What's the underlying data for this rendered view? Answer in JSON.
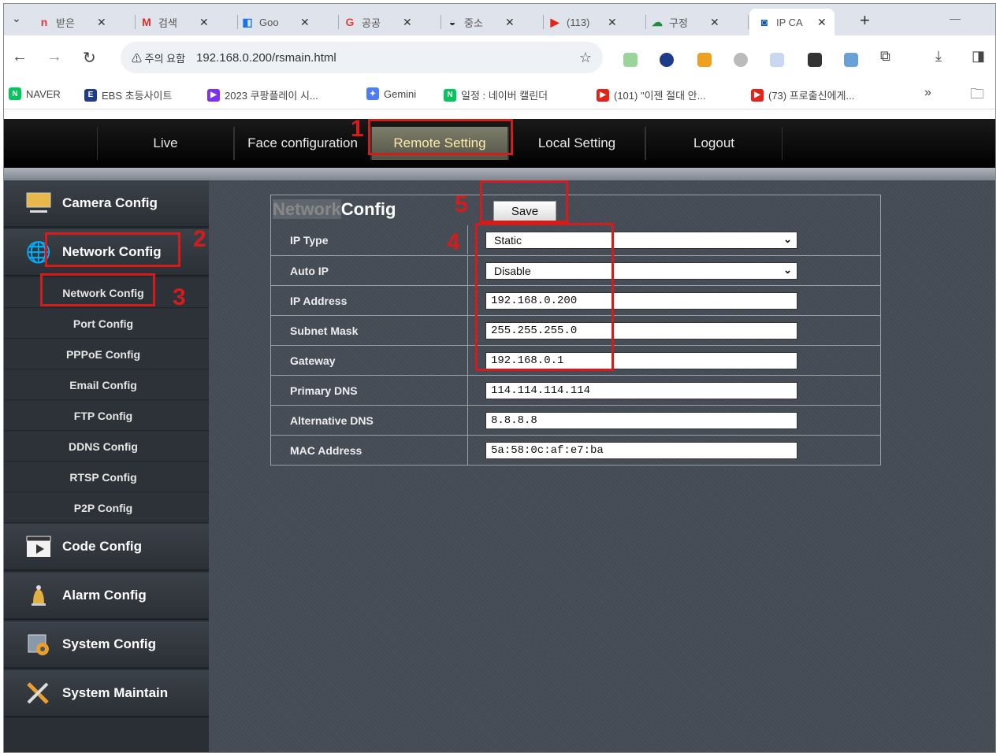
{
  "browser": {
    "tabs": [
      {
        "icon": "n",
        "label": "받은",
        "color": "#e8363c"
      },
      {
        "icon": "M",
        "label": "검색",
        "color": "#d93025"
      },
      {
        "icon": "◧",
        "label": "Goo",
        "color": "#1a73e8"
      },
      {
        "icon": "G",
        "label": "공공",
        "color": "#ea4335"
      },
      {
        "icon": "◒",
        "label": "중소",
        "color": "#333333"
      },
      {
        "icon": "▶",
        "label": "(113)",
        "color": "#e62117"
      },
      {
        "icon": "☁",
        "label": "구정",
        "color": "#1e8e3e"
      },
      {
        "icon": "◙",
        "label": "IP CA",
        "color": "#0b57a6"
      }
    ],
    "new_tab": "+",
    "minimize": "—",
    "tab_close": "✕",
    "url": "192.168.0.200/rsmain.html",
    "security_label": "⚠ 주의 요함",
    "bookmarks": [
      {
        "label": "NAVER",
        "icon": "N",
        "color": "#03c75a"
      },
      {
        "label": "EBS 초등사이트",
        "icon": "E",
        "color": "#1f3c88"
      },
      {
        "label": "2023 쿠팡플레이 시...",
        "icon": "▶",
        "color": "#7b2ff7"
      },
      {
        "label": "Gemini",
        "icon": "✦",
        "color": "#4e7cf6"
      },
      {
        "label": "일정 : 네이버 캘린더",
        "icon": "N",
        "color": "#03c75a"
      },
      {
        "label": "(101) \"이젠 절대 안...",
        "icon": "▶",
        "color": "#e62117"
      },
      {
        "label": "(73) 프로출신에게...",
        "icon": "▶",
        "color": "#e62117"
      }
    ],
    "more_bookmarks": "»"
  },
  "app": {
    "menu": [
      "Live",
      "Face configuration",
      "Remote Setting",
      "Local Setting",
      "Logout"
    ],
    "active_menu": "Remote Setting",
    "sidebar": {
      "camera": "Camera Config",
      "network": "Network Config",
      "subitems": [
        "Network Config",
        "Port Config",
        "PPPoE Config",
        "Email Config",
        "FTP Config",
        "DDNS Config",
        "RTSP Config",
        "P2P Config"
      ],
      "code": "Code Config",
      "alarm": "Alarm Config",
      "system": "System Config",
      "maintain": "System Maintain"
    },
    "panel": {
      "title_part1": "Network",
      "title_part2": "Config",
      "save_label": "Save",
      "rows": [
        {
          "label": "IP Type",
          "value": "Static",
          "type": "select"
        },
        {
          "label": "Auto IP",
          "value": "Disable",
          "type": "select"
        },
        {
          "label": "IP Address",
          "value": "192.168.0.200",
          "type": "text"
        },
        {
          "label": "Subnet Mask",
          "value": "255.255.255.0",
          "type": "text"
        },
        {
          "label": "Gateway",
          "value": "192.168.0.1",
          "type": "text"
        },
        {
          "label": "Primary DNS",
          "value": "114.114.114.114",
          "type": "text"
        },
        {
          "label": "Alternative DNS",
          "value": "8.8.8.8",
          "type": "text"
        },
        {
          "label": "MAC Address",
          "value": "5a:58:0c:af:e7:ba",
          "type": "text"
        }
      ]
    }
  },
  "annotations": [
    "1",
    "2",
    "3",
    "4",
    "5"
  ],
  "colors": {
    "annotation": "#d41c1c",
    "menu_active": "#ffe9a8"
  }
}
